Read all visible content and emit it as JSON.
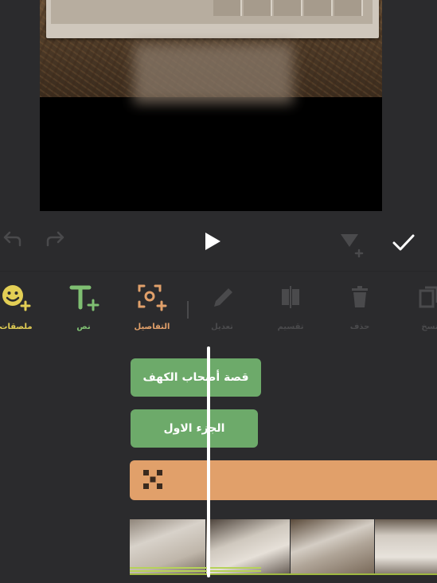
{
  "toolbar": {
    "items": [
      {
        "label": "ملصقات",
        "icon": "sticker-add-icon",
        "color": "#e3cf55",
        "enabled": true
      },
      {
        "label": "نص",
        "icon": "text-add-icon",
        "color": "#7fbf72",
        "enabled": true
      },
      {
        "label": "التفاصيل",
        "icon": "mosaic-focus-icon",
        "color": "#e1a06a",
        "enabled": true
      },
      {
        "label": "تعديل",
        "icon": "pencil-icon",
        "color": "#4a4a4c",
        "enabled": false
      },
      {
        "label": "تقسيم",
        "icon": "split-icon",
        "color": "#4a4a4c",
        "enabled": false
      },
      {
        "label": "حذف",
        "icon": "trash-icon",
        "color": "#4a4a4c",
        "enabled": false
      },
      {
        "label": "نسخ",
        "icon": "copy-icon",
        "color": "#4a4a4c",
        "enabled": false
      }
    ]
  },
  "timeline": {
    "text_clips": [
      {
        "text": "قصة أصحاب الكهف",
        "color": "#6daa6a"
      },
      {
        "text": "الجزء الاول",
        "color": "#6daa6a"
      }
    ],
    "effect_clip": {
      "icon": "mosaic-icon",
      "color": "#e1a06a"
    },
    "playhead_color": "#ffffff"
  },
  "controls": {
    "undo": "undo-icon",
    "redo": "redo-icon",
    "play": "play-icon",
    "filter": "filter-add-icon",
    "confirm": "check-icon"
  }
}
